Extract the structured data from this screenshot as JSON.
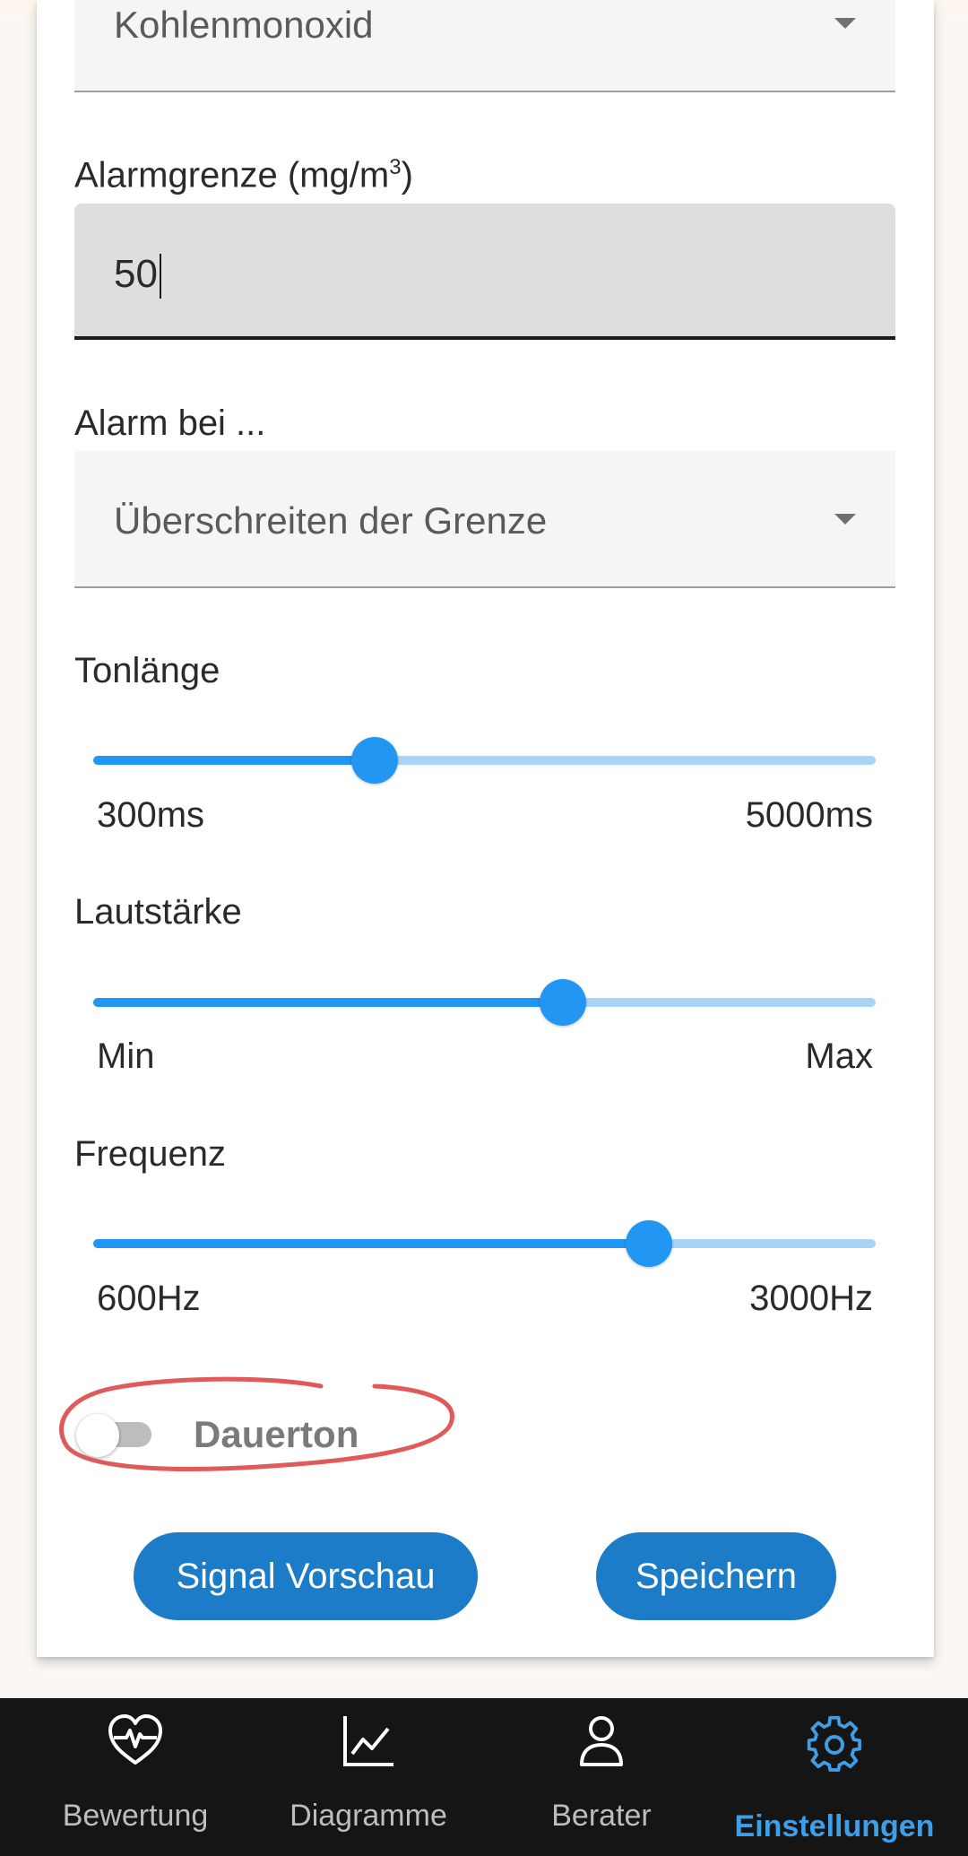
{
  "gas_select": {
    "value": "Kohlenmonoxid"
  },
  "alarm_limit": {
    "label": "Alarmgrenze  (mg/m",
    "unit_exp": "3",
    "label_end": ")",
    "value": "50"
  },
  "alarm_on": {
    "label": "Alarm bei ...",
    "value": "Überschreiten der Grenze"
  },
  "sliders": {
    "tone_length": {
      "label": "Tonlänge",
      "min_label": "300ms",
      "max_label": "5000ms",
      "level": 0.36
    },
    "volume": {
      "label": "Lautstärke",
      "min_label": "Min",
      "max_label": "Max",
      "level": 0.6
    },
    "frequency": {
      "label": "Frequenz",
      "min_label": "600Hz",
      "max_label": "3000Hz",
      "level": 0.71
    }
  },
  "continuous_tone": {
    "label": "Dauerton",
    "enabled": false
  },
  "buttons": {
    "preview": "Signal Vorschau",
    "save": "Speichern"
  },
  "colors": {
    "accent": "#2196f3",
    "track_inactive": "#a8d4f8",
    "button": "#1c7cc8",
    "nav_active": "#3f9ee8",
    "annotation": "#e05a5a"
  },
  "nav": [
    {
      "label": "Bewertung",
      "icon": "heart-pulse-icon"
    },
    {
      "label": "Diagramme",
      "icon": "chart-line-icon"
    },
    {
      "label": "Berater",
      "icon": "person-icon"
    },
    {
      "label": "Einstellungen",
      "icon": "gear-icon",
      "active": true
    }
  ]
}
